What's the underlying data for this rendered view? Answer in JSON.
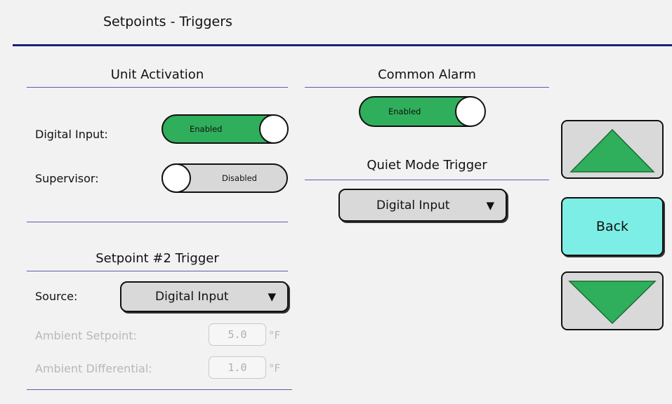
{
  "header": {
    "title": "Setpoints - Triggers"
  },
  "unit_activation": {
    "heading": "Unit Activation",
    "digital_input": {
      "label": "Digital Input:",
      "state": "Enabled"
    },
    "supervisor": {
      "label": "Supervisor:",
      "state": "Disabled"
    }
  },
  "setpoint2": {
    "heading": "Setpoint #2 Trigger",
    "source": {
      "label": "Source:",
      "value": "Digital Input"
    },
    "ambient_setpoint": {
      "label": "Ambient Setpoint:",
      "value": "5.0",
      "unit": "°F"
    },
    "ambient_differential": {
      "label": "Ambient Differential:",
      "value": "1.0",
      "unit": "°F"
    }
  },
  "common_alarm": {
    "heading": "Common Alarm",
    "state": "Enabled"
  },
  "quiet_mode": {
    "heading": "Quiet Mode Trigger",
    "value": "Digital Input"
  },
  "nav": {
    "back_label": "Back"
  },
  "icons": {
    "dropdown_arrow": "▼"
  },
  "colors": {
    "enabled": "#2faf5b",
    "disabled": "#d8d8d8",
    "back": "#7deee6",
    "header_rule": "#16237a"
  }
}
